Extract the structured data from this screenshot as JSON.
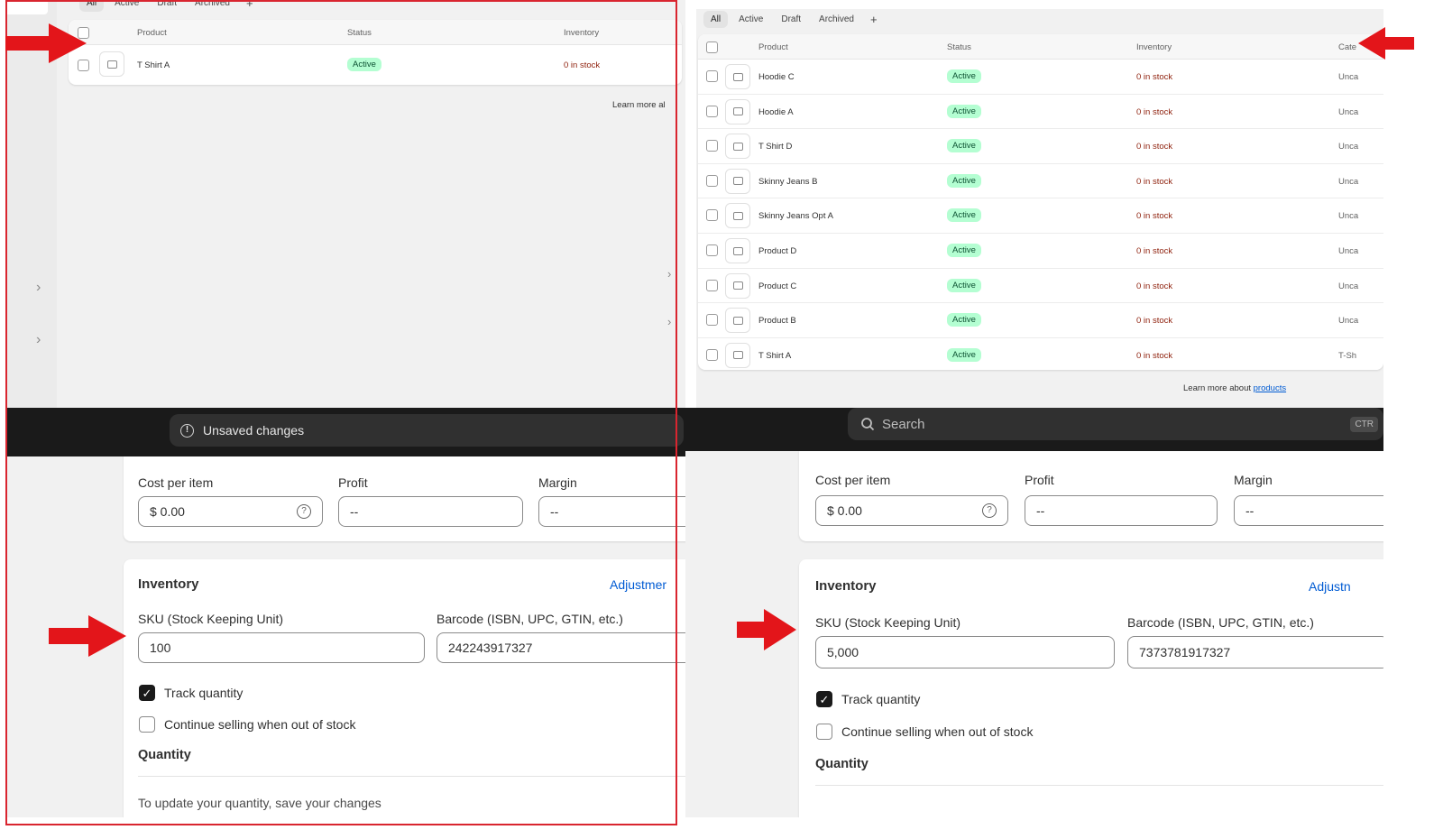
{
  "top_left": {
    "tabs": [
      "All",
      "Active",
      "Draft",
      "Archived",
      "+"
    ],
    "headers": {
      "product": "Product",
      "status": "Status",
      "inventory": "Inventory"
    },
    "rows": [
      {
        "name": "T Shirt A",
        "status": "Active",
        "inventory": "0 in stock"
      }
    ],
    "learn_more": "Learn more al"
  },
  "top_right": {
    "tabs": [
      "All",
      "Active",
      "Draft",
      "Archived",
      "+"
    ],
    "headers": {
      "product": "Product",
      "status": "Status",
      "inventory": "Inventory",
      "category": "Cate"
    },
    "rows": [
      {
        "name": "Hoodie C",
        "status": "Active",
        "inventory": "0 in stock",
        "category": "Unca"
      },
      {
        "name": "Hoodie A",
        "status": "Active",
        "inventory": "0 in stock",
        "category": "Unca"
      },
      {
        "name": "T Shirt D",
        "status": "Active",
        "inventory": "0 in stock",
        "category": "Unca"
      },
      {
        "name": "Skinny Jeans B",
        "status": "Active",
        "inventory": "0 in stock",
        "category": "Unca"
      },
      {
        "name": "Skinny Jeans Opt A",
        "status": "Active",
        "inventory": "0 in stock",
        "category": "Unca"
      },
      {
        "name": "Product D",
        "status": "Active",
        "inventory": "0 in stock",
        "category": "Unca"
      },
      {
        "name": "Product C",
        "status": "Active",
        "inventory": "0 in stock",
        "category": "Unca"
      },
      {
        "name": "Product B",
        "status": "Active",
        "inventory": "0 in stock",
        "category": "Unca"
      },
      {
        "name": "T Shirt A",
        "status": "Active",
        "inventory": "0 in stock",
        "category": "T-Sh"
      }
    ],
    "learn_more": "Learn more about",
    "learn_more_link": "products"
  },
  "topbar": {
    "unsaved": "Unsaved changes",
    "search": "Search",
    "shortcut": "CTR"
  },
  "bottom_left": {
    "cost_label": "Cost per item",
    "cost_value": "$  0.00",
    "profit_label": "Profit",
    "profit_value": "--",
    "margin_label": "Margin",
    "margin_value": "--",
    "inventory_title": "Inventory",
    "adjust_link": "Adjustmer",
    "sku_label": "SKU (Stock Keeping Unit)",
    "sku_value": "100",
    "barcode_label": "Barcode (ISBN, UPC, GTIN, etc.)",
    "barcode_value": "242243917327",
    "track_label": "Track quantity",
    "continue_label": "Continue selling when out of stock",
    "quantity_title": "Quantity",
    "quantity_note": "To update your quantity, save your changes"
  },
  "bottom_right": {
    "cost_label": "Cost per item",
    "cost_value": "$  0.00",
    "profit_label": "Profit",
    "profit_value": "--",
    "margin_label": "Margin",
    "margin_value": "--",
    "inventory_title": "Inventory",
    "adjust_link": "Adjustn",
    "sku_label": "SKU (Stock Keeping Unit)",
    "sku_value": "5,000",
    "barcode_label": "Barcode (ISBN, UPC, GTIN, etc.)",
    "barcode_value": "7373781917327",
    "track_label": "Track quantity",
    "continue_label": "Continue selling when out of stock",
    "quantity_title": "Quantity"
  },
  "colors": {
    "annotation_red": "#e3151a",
    "active_badge": "#b4fed2",
    "stock_red": "#8e1f0b"
  }
}
